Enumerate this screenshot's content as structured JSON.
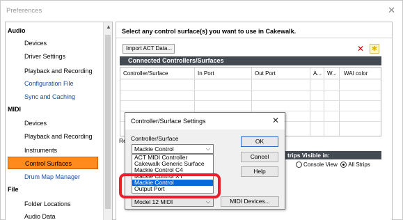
{
  "window": {
    "title": "Preferences",
    "close_glyph": "✕"
  },
  "sidebar": {
    "items": [
      {
        "label": "Audio",
        "kind": "category"
      },
      {
        "label": "Devices",
        "kind": "sub"
      },
      {
        "label": "Driver Settings",
        "kind": "sub"
      },
      {
        "label": "Playback and Recording",
        "kind": "sub"
      },
      {
        "label": "Configuration File",
        "kind": "sub-blue"
      },
      {
        "label": "Sync and Caching",
        "kind": "sub-blue"
      },
      {
        "label": "MIDI",
        "kind": "category"
      },
      {
        "label": "Devices",
        "kind": "sub"
      },
      {
        "label": "Playback and Recording",
        "kind": "sub"
      },
      {
        "label": "Instruments",
        "kind": "sub"
      },
      {
        "label": "Control Surfaces",
        "kind": "active"
      },
      {
        "label": "Drum Map Manager",
        "kind": "sub-blue"
      },
      {
        "label": "File",
        "kind": "category"
      },
      {
        "label": "Folder Locations",
        "kind": "sub"
      },
      {
        "label": "Audio Data",
        "kind": "sub"
      }
    ],
    "active_color": "#ff8a1e"
  },
  "main": {
    "heading": "Select any control surface(s) you want to use in Cakewalk.",
    "import_button": "Import ACT Data...",
    "delete_icon": "delete-icon",
    "add_icon": "add-icon",
    "section_title": "Connected Controllers/Surfaces",
    "columns": [
      "Controller/Surface",
      "In Port",
      "Out Port",
      "A...",
      "W...",
      "WAI color"
    ],
    "fragment_left": "Re",
    "strips_bar": "trips Visible in:",
    "radio_options": [
      {
        "label": "Console View",
        "checked": false
      },
      {
        "label": "All Strips",
        "checked": true
      }
    ]
  },
  "dialog": {
    "title": "Controller/Surface Settings",
    "close_glyph": "✕",
    "field_label": "Controller/Surface",
    "selected_value": "Mackie Control",
    "dropdown_options": [
      {
        "label": "ACT MIDI Controller",
        "selected": false
      },
      {
        "label": "Cakewalk Generic Surface",
        "selected": false
      },
      {
        "label": "Mackie Control C4",
        "selected": false
      },
      {
        "label": "Mackie Control XT",
        "selected": false
      },
      {
        "label": "Mackie Control",
        "selected": true
      },
      {
        "label": "Output Port",
        "selected": false
      }
    ],
    "ok_label": "OK",
    "cancel_label": "Cancel",
    "help_label": "Help",
    "second_select": "Model 12 MIDI",
    "midi_devices_label": "MIDI Devices...",
    "highlight_color": "#e8202a"
  }
}
